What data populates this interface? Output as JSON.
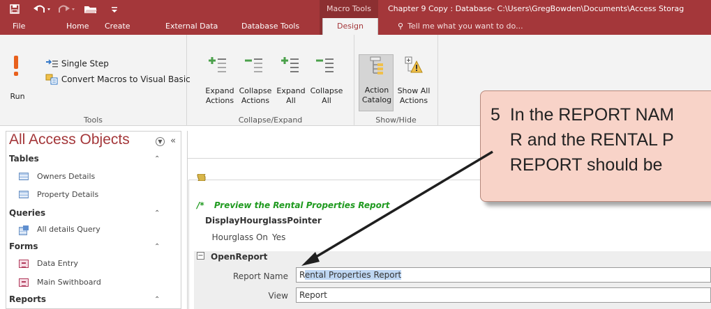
{
  "titlebar": {
    "context_label": "Macro Tools",
    "doc_title": "Chapter 9 Copy : Database- C:\\Users\\GregBowden\\Documents\\Access Storag"
  },
  "quick_access": {
    "save_icon": "save-icon",
    "undo_icon": "undo-icon",
    "redo_icon": "redo-icon",
    "open_icon": "open-folder-icon",
    "customize_icon": "customize-qat-icon"
  },
  "tabs": [
    "File",
    "Home",
    "Create",
    "External Data",
    "Database Tools",
    "Design"
  ],
  "active_tab": "Design",
  "tell_me": "Tell me what you want to do...",
  "ribbon": {
    "tools": {
      "run_label": "Run",
      "single_step": "Single Step",
      "convert": "Convert Macros to Visual Basic",
      "group": "Tools"
    },
    "collapse_expand": {
      "expand_actions": [
        "Expand",
        "Actions"
      ],
      "collapse_actions": [
        "Collapse",
        "Actions"
      ],
      "expand_all": [
        "Expand",
        "All"
      ],
      "collapse_all": [
        "Collapse",
        "All"
      ],
      "group": "Collapse/Expand"
    },
    "show_hide": {
      "action_catalog": [
        "Action",
        "Catalog"
      ],
      "show_all_actions": [
        "Show All",
        "Actions"
      ],
      "group": "Show/Hide"
    }
  },
  "nav": {
    "title": "All Access Objects",
    "sections": [
      {
        "label": "Tables",
        "items": [
          "Owners Details",
          "Property Details"
        ]
      },
      {
        "label": "Queries",
        "items": [
          "All details Query"
        ]
      },
      {
        "label": "Forms",
        "items": [
          "Data Entry",
          "Main Swithboard"
        ]
      },
      {
        "label": "Reports",
        "items": []
      }
    ]
  },
  "macro": {
    "comment_prefix": "/*",
    "comment_text": "Preview the Rental Properties Report",
    "action1": "DisplayHourglassPointer",
    "hourglass_label": "Hourglass On",
    "hourglass_value": "Yes",
    "action2": "OpenReport",
    "report_name_label": "Report Name",
    "report_name_first": "R",
    "report_name_rest": "ental Properties Report",
    "view_label": "View",
    "view_value": "Report"
  },
  "callout": {
    "step": "5",
    "line1": "In the REPORT NAM",
    "line2": "R and the RENTAL P",
    "line3": "REPORT should be"
  },
  "colors": {
    "accent": "#a4373a",
    "ribbon_bg": "#f3f3f3",
    "comment_green": "#1f9a1f",
    "callout_bg": "#f8d3c8",
    "selection": "#bfd7f3"
  }
}
